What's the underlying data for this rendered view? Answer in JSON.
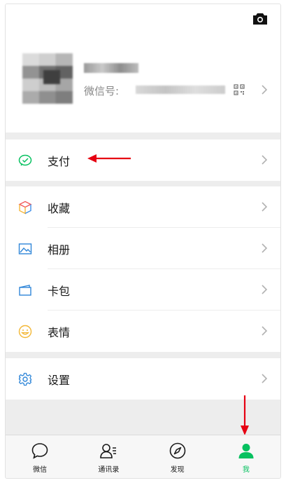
{
  "profile": {
    "wechat_id_label": "微信号:"
  },
  "menu": {
    "pay": "支付",
    "favorites": "收藏",
    "album": "相册",
    "cards": "卡包",
    "stickers": "表情",
    "settings": "设置"
  },
  "tabs": [
    {
      "label": "微信",
      "icon": "chat-bubble-icon"
    },
    {
      "label": "通讯录",
      "icon": "contacts-icon"
    },
    {
      "label": "发现",
      "icon": "compass-icon"
    },
    {
      "label": "我",
      "icon": "person-icon",
      "active": true
    }
  ],
  "colors": {
    "accent": "#07c160",
    "annotation_arrow": "#e60012",
    "text": "#191919",
    "secondary_text": "#888888",
    "background": "#ededed"
  }
}
